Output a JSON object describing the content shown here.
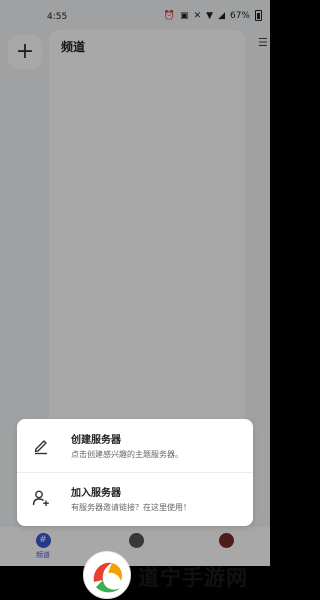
{
  "status_bar": {
    "time": "4:55",
    "battery": "67%"
  },
  "rail": {
    "add_label": "+"
  },
  "panel": {
    "title": "频道"
  },
  "popup": {
    "create": {
      "title": "创建服务器",
      "desc": "点击创建感兴趣的主题服务器。"
    },
    "join": {
      "title": "加入服务器",
      "desc": "有服务器邀请链接？在这里使用！"
    }
  },
  "bottom_nav": {
    "channels_label": "频道",
    "channels_glyph": "#"
  },
  "watermark": {
    "text": "道宁手游网"
  },
  "colors": {
    "accent": "#3a57d9"
  }
}
